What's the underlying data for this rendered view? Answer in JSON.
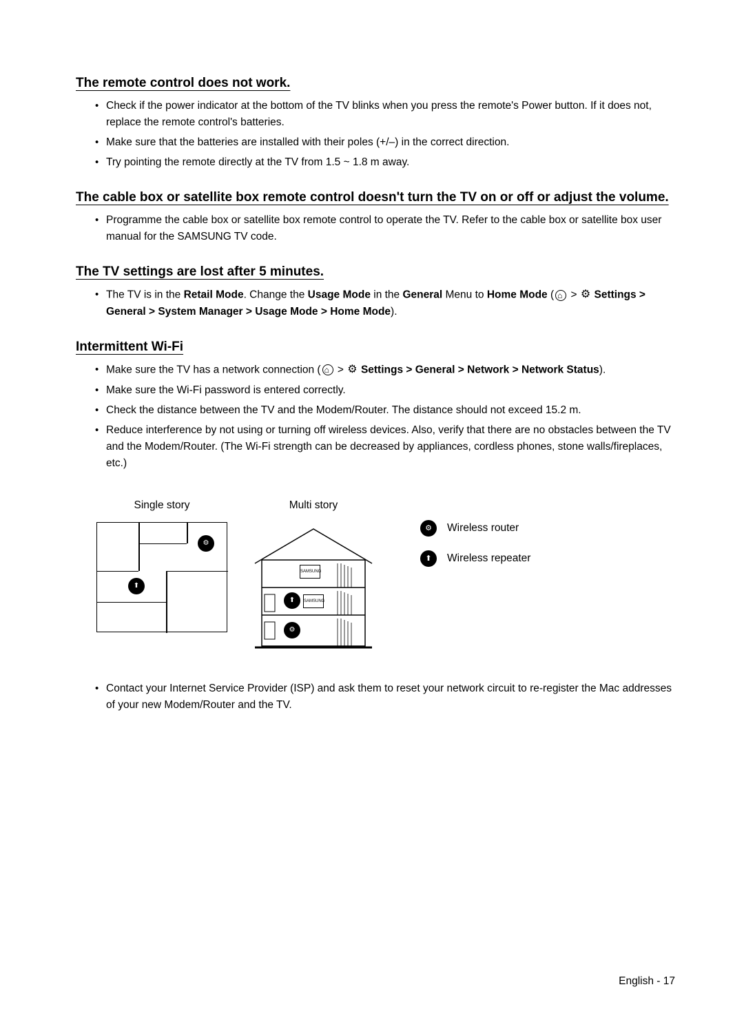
{
  "sections": [
    {
      "heading": "The remote control does not work.",
      "items": [
        {
          "text": "Check if the power indicator at the bottom of the TV blinks when you press the remote's Power button. If it does not, replace the remote control's batteries."
        },
        {
          "text": "Make sure that the batteries are installed with their poles (+/–) in the correct direction."
        },
        {
          "text": "Try pointing the remote directly at the TV from 1.5 ~ 1.8 m away."
        }
      ]
    },
    {
      "heading": "The cable box or satellite box remote control doesn't turn the TV on or off or adjust the volume.",
      "items": [
        {
          "text": "Programme the cable box or satellite box remote control to operate the TV. Refer to the cable box or satellite box user manual for the SAMSUNG TV code."
        }
      ]
    },
    {
      "heading": "The TV settings are lost after 5 minutes.",
      "items": [
        {
          "html": true,
          "parts": [
            {
              "t": "The TV is in the "
            },
            {
              "t": "Retail Mode",
              "b": true
            },
            {
              "t": ". Change the "
            },
            {
              "t": "Usage Mode",
              "b": true
            },
            {
              "t": " in the "
            },
            {
              "t": "General",
              "b": true
            },
            {
              "t": " Menu to "
            },
            {
              "t": "Home Mode",
              "b": true
            },
            {
              "t": " ("
            },
            {
              "icon": "home"
            },
            {
              "t": " > "
            },
            {
              "icon": "gear"
            },
            {
              "t": " "
            },
            {
              "t": "Settings > General > System Manager > Usage Mode > Home Mode",
              "b": true
            },
            {
              "t": ")."
            }
          ]
        }
      ]
    },
    {
      "heading": "Intermittent Wi-Fi",
      "items": [
        {
          "html": true,
          "parts": [
            {
              "t": "Make sure the TV has a network connection ("
            },
            {
              "icon": "home"
            },
            {
              "t": " > "
            },
            {
              "icon": "gear"
            },
            {
              "t": " "
            },
            {
              "t": "Settings > General > Network > Network Status",
              "b": true
            },
            {
              "t": ")."
            }
          ]
        },
        {
          "text": "Make sure the Wi-Fi password is entered correctly."
        },
        {
          "text": "Check the distance between the TV and the Modem/Router. The distance should not exceed 15.2 m."
        },
        {
          "text": "Reduce interference by not using or turning off wireless devices. Also, verify that there are no obstacles between the TV and the Modem/Router. (The Wi-Fi strength can be decreased by appliances, cordless phones, stone walls/fireplaces, etc.)"
        }
      ]
    }
  ],
  "diagrams": {
    "single": "Single story",
    "multi": "Multi story"
  },
  "legend": {
    "router": "Wireless router",
    "repeater": "Wireless repeater"
  },
  "postDiagramItem": "Contact your Internet Service Provider (ISP) and ask them to reset your network circuit to re-register the Mac addresses of your new Modem/Router and the TV.",
  "footer": {
    "lang": "English",
    "sep": " - ",
    "page": "17"
  }
}
